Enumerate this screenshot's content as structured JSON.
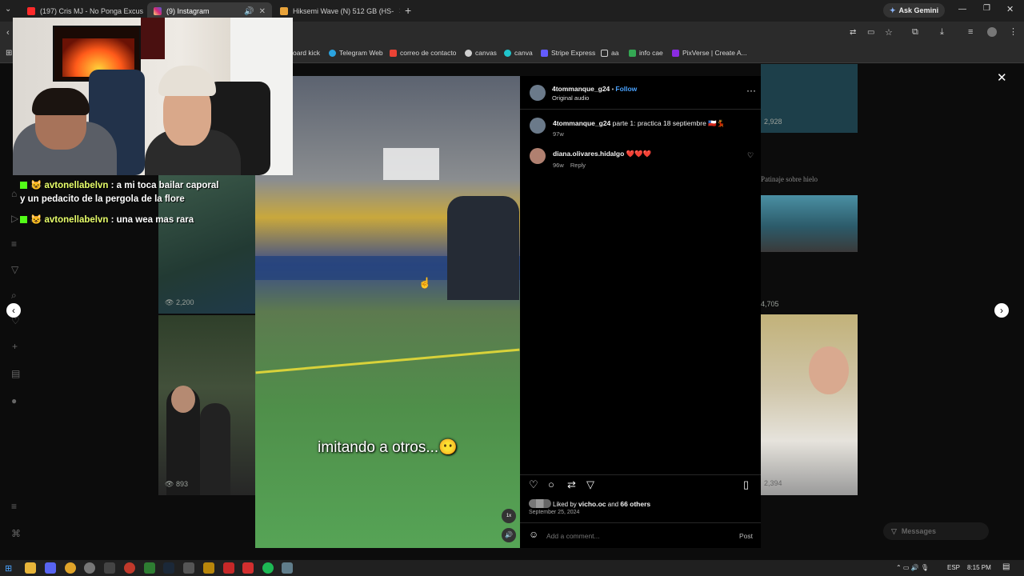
{
  "tabs": [
    {
      "title": "(197) Cris MJ - No Ponga Excus",
      "icon": "youtube-icon",
      "color": "#ff2a2a"
    },
    {
      "title": "(9) Instagram",
      "icon": "instagram-icon",
      "color": "#d6249f"
    },
    {
      "title": "Hiksemi Wave (N) 512 GB (HS-",
      "icon": "store-icon",
      "color": "#e8a33a"
    }
  ],
  "ask_gemini": "Ask Gemini",
  "bookmarks": [
    {
      "label": "oard kick",
      "color": "#53fc18"
    },
    {
      "label": "Telegram Web",
      "color": "#2aa3e0"
    },
    {
      "label": "correo de contacto",
      "color": "#ea4335"
    },
    {
      "label": "canvas",
      "color": "#cfcfcf"
    },
    {
      "label": "canva",
      "color": "#20c4cb"
    },
    {
      "label": "Stripe Express",
      "color": "#635bff"
    },
    {
      "label": "aa",
      "color": "#cfcfcf"
    },
    {
      "label": "info cae",
      "color": "#34a853"
    },
    {
      "label": "PixVerse | Create A...",
      "color": "#8a2be2"
    }
  ],
  "chat": [
    {
      "user": "avtonellabelvn",
      "text": " : a mi toca bailar caporal",
      "continuation": "y un pedacito de la pergola de la flore"
    },
    {
      "user": "avtonellabelvn",
      "text": " : una wea mas rara",
      "continuation": ""
    }
  ],
  "grid": {
    "left_views": [
      "2,200",
      "893"
    ],
    "right_views": [
      "2,928",
      "4,705",
      "2,394"
    ],
    "right_caption": "Patinaje sobre hielo"
  },
  "video": {
    "overlay_text": "imitando a otros...😶",
    "speed": "1x"
  },
  "post": {
    "author": "4tommanque_g24",
    "follow_label": "Follow",
    "audio": "Original audio",
    "caption_text": "parte 1: practica 18 septiembre 🇨🇱💃",
    "caption_time": "97w",
    "comments": [
      {
        "user": "diana.olivares.hidalgo",
        "text": "❤️❤️❤️",
        "time": "96w",
        "reply": "Reply"
      }
    ],
    "liked_by_prefix": "Liked by",
    "liked_user": "vicho.oc",
    "liked_and": "and",
    "liked_others": "66 others",
    "date": "September 25, 2024",
    "add_comment_placeholder": "Add a comment...",
    "post_button": "Post"
  },
  "messages_label": "Messages",
  "tray": {
    "lang": "ESP",
    "time": "8:15 PM"
  }
}
